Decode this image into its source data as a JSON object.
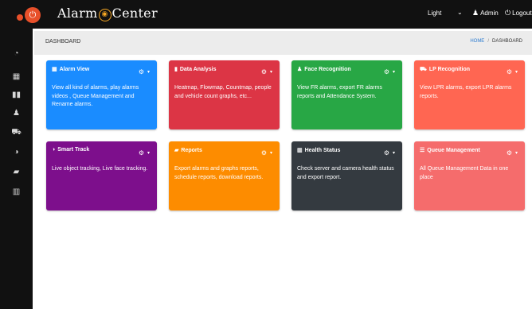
{
  "brand": {
    "text_before": "Alarm",
    "text_after": "Center",
    "bell_glyph": "🔔",
    "logo_icon": "power-icon"
  },
  "header": {
    "theme_value": "Light",
    "user_label": "Admin",
    "logout_label": "Logout"
  },
  "sidebar": {
    "items": [
      {
        "name": "sidebar-item-dashboard",
        "icon": "dashboard-icon",
        "glyph": "◔"
      },
      {
        "name": "sidebar-item-alarms",
        "icon": "grid-icon",
        "glyph": "▦"
      },
      {
        "name": "sidebar-item-analytics",
        "icon": "map-icon",
        "glyph": "▮▮"
      },
      {
        "name": "sidebar-item-face",
        "icon": "user-icon",
        "glyph": "♟"
      },
      {
        "name": "sidebar-item-lpr",
        "icon": "car-icon",
        "glyph": "⛟"
      },
      {
        "name": "sidebar-item-track",
        "icon": "contrast-icon",
        "glyph": "◑"
      },
      {
        "name": "sidebar-item-reports",
        "icon": "file-icon",
        "glyph": "▰"
      },
      {
        "name": "sidebar-item-health",
        "icon": "chart-icon",
        "glyph": "▥"
      }
    ]
  },
  "breadcrumb": {
    "title": "DASHBOARD",
    "home": "HOME",
    "current": "DASHBOARD"
  },
  "cards": [
    {
      "title": "Alarm View",
      "icon": "calendar-icon",
      "glyph": "▦",
      "color": "#1a8cff",
      "desc": "View all kind of alarms, play alarms videos , Queue Management and Rename alarms."
    },
    {
      "title": "Data Analysis",
      "icon": "map-icon",
      "glyph": "▮",
      "color": "#dc3545",
      "desc": "Heatmap, Flowmap, Countmap, people and vehicle count graphs, etc..."
    },
    {
      "title": "Face Recognition",
      "icon": "user-icon",
      "glyph": "♟",
      "color": "#28a745",
      "desc": "View FR alarms, export FR alarms reports and Attendance System."
    },
    {
      "title": "LP Recognition",
      "icon": "car-icon",
      "glyph": "⛟",
      "color": "#ff6652",
      "desc": "View LPR alarms, export LPR alarms reports."
    },
    {
      "title": "Smart Track",
      "icon": "contrast-icon",
      "glyph": "◑",
      "color": "#7d0f8c",
      "desc": "Live object tracking, Live face tracking."
    },
    {
      "title": "Reports",
      "icon": "file-icon",
      "glyph": "▰",
      "color": "#fd8c00",
      "desc": "Export alarms and graphs reports, schedule reports, download reports."
    },
    {
      "title": "Health Status",
      "icon": "chart-icon",
      "glyph": "▥",
      "color": "#343a40",
      "desc": "Check server and camera health status and export report."
    },
    {
      "title": "Queue Management",
      "icon": "list-icon",
      "glyph": "☰",
      "color": "#f56c6c",
      "desc": "All Queue Management Data in one place"
    }
  ]
}
